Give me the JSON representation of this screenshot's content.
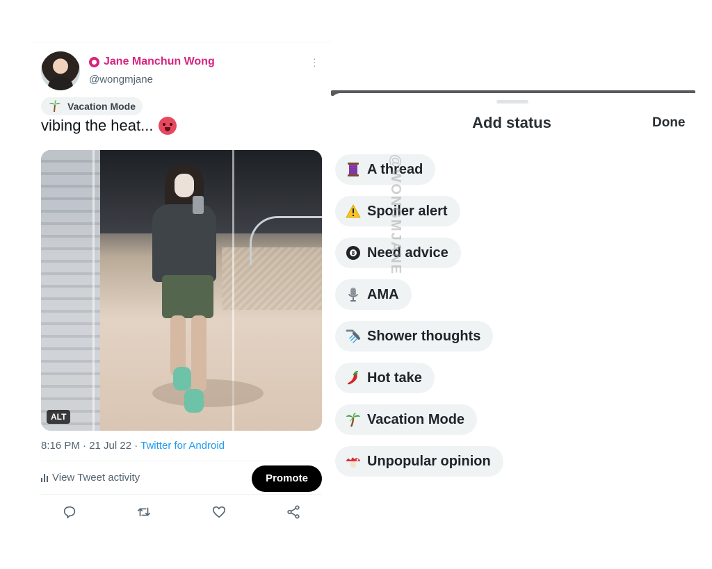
{
  "tweet": {
    "author_name": "Jane Manchun Wong",
    "handle": "@wongmjane",
    "status_pill": "Vacation Mode",
    "text": "vibing the heat...",
    "alt_badge": "ALT",
    "timestamp": "8:16 PM · 21 Jul 22 · ",
    "source": "Twitter for Android",
    "activity_label": "View Tweet activity",
    "promote_label": "Promote",
    "accent_color": "#d6247f",
    "actions": [
      "reply-icon",
      "retweet-icon",
      "like-icon",
      "share-icon"
    ]
  },
  "status_sheet": {
    "title": "Add status",
    "done_label": "Done",
    "options": [
      {
        "label": "A thread",
        "icon": "spool-icon"
      },
      {
        "label": "Spoiler alert",
        "icon": "warning-icon"
      },
      {
        "label": "Need advice",
        "icon": "eight-ball-icon"
      },
      {
        "label": "AMA",
        "icon": "microphone-icon"
      },
      {
        "label": "Shower thoughts",
        "icon": "shower-icon"
      },
      {
        "label": "Hot take",
        "icon": "chili-pepper-icon"
      },
      {
        "label": "Vacation Mode",
        "icon": "palm-tree-icon"
      },
      {
        "label": "Unpopular opinion",
        "icon": "mushroom-icon"
      }
    ]
  },
  "watermark": "@WONGMJANE"
}
